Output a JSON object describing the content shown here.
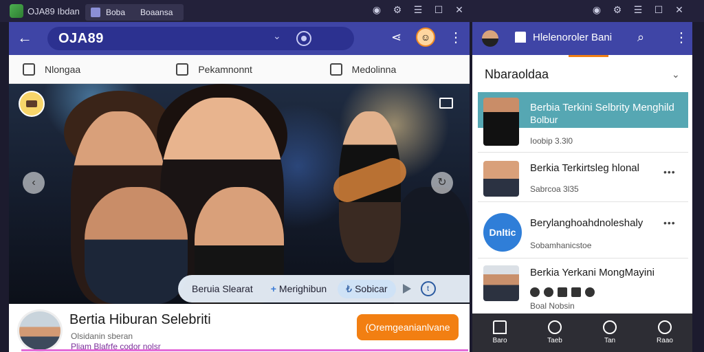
{
  "titlebar": {
    "app_name": "OJA89 Ibdan",
    "tab_label": "Boba",
    "tab_sub": "Boaansa"
  },
  "left_window": {
    "header": {
      "title": "OJA89"
    },
    "nav": [
      {
        "label": "Nlongaa",
        "icon": "bookmark-icon"
      },
      {
        "label": "Pekamnonnt",
        "icon": "pen-icon"
      },
      {
        "label": "Medolinna",
        "icon": "frame-icon"
      }
    ],
    "chips": [
      {
        "label": "Beruia Slearat",
        "type": "plain"
      },
      {
        "label": "Merighibun",
        "type": "plus"
      },
      {
        "label": "Sobicar",
        "type": "selected"
      }
    ],
    "info": {
      "title": "Bertia Hiburan Selebriti",
      "subtitle": "Olsidanin sberan",
      "meta": "Pliam Blafrfe codor nolsr",
      "button": "(Oremgeanianlvane"
    }
  },
  "right_window": {
    "header": {
      "title": "Hlelenoroler Bani"
    },
    "section": "Nbaraoldaa",
    "cards": [
      {
        "title": "Berbia Terkini Selbrity Menghild",
        "title2": "Bolbur",
        "sub": "Ioobip 3.3l0"
      },
      {
        "title": "Berkia Terkirtsleg hlonal",
        "sub": "Sabrcoa 3l35"
      },
      {
        "thumb_text": "Dnltic",
        "title": "Berylanghoahdnoleshaly",
        "sub": "Sobamhanicstoe"
      },
      {
        "title": "Berkia Yerkani MongMayini",
        "sub": "Boal Nobsin"
      }
    ],
    "bottom_nav": [
      "Baro",
      "Taeb",
      "Tan",
      "Raao"
    ]
  },
  "colors": {
    "header": "#3f45a6",
    "accent": "#f27f12",
    "card_highlight": "#56a7b3"
  }
}
